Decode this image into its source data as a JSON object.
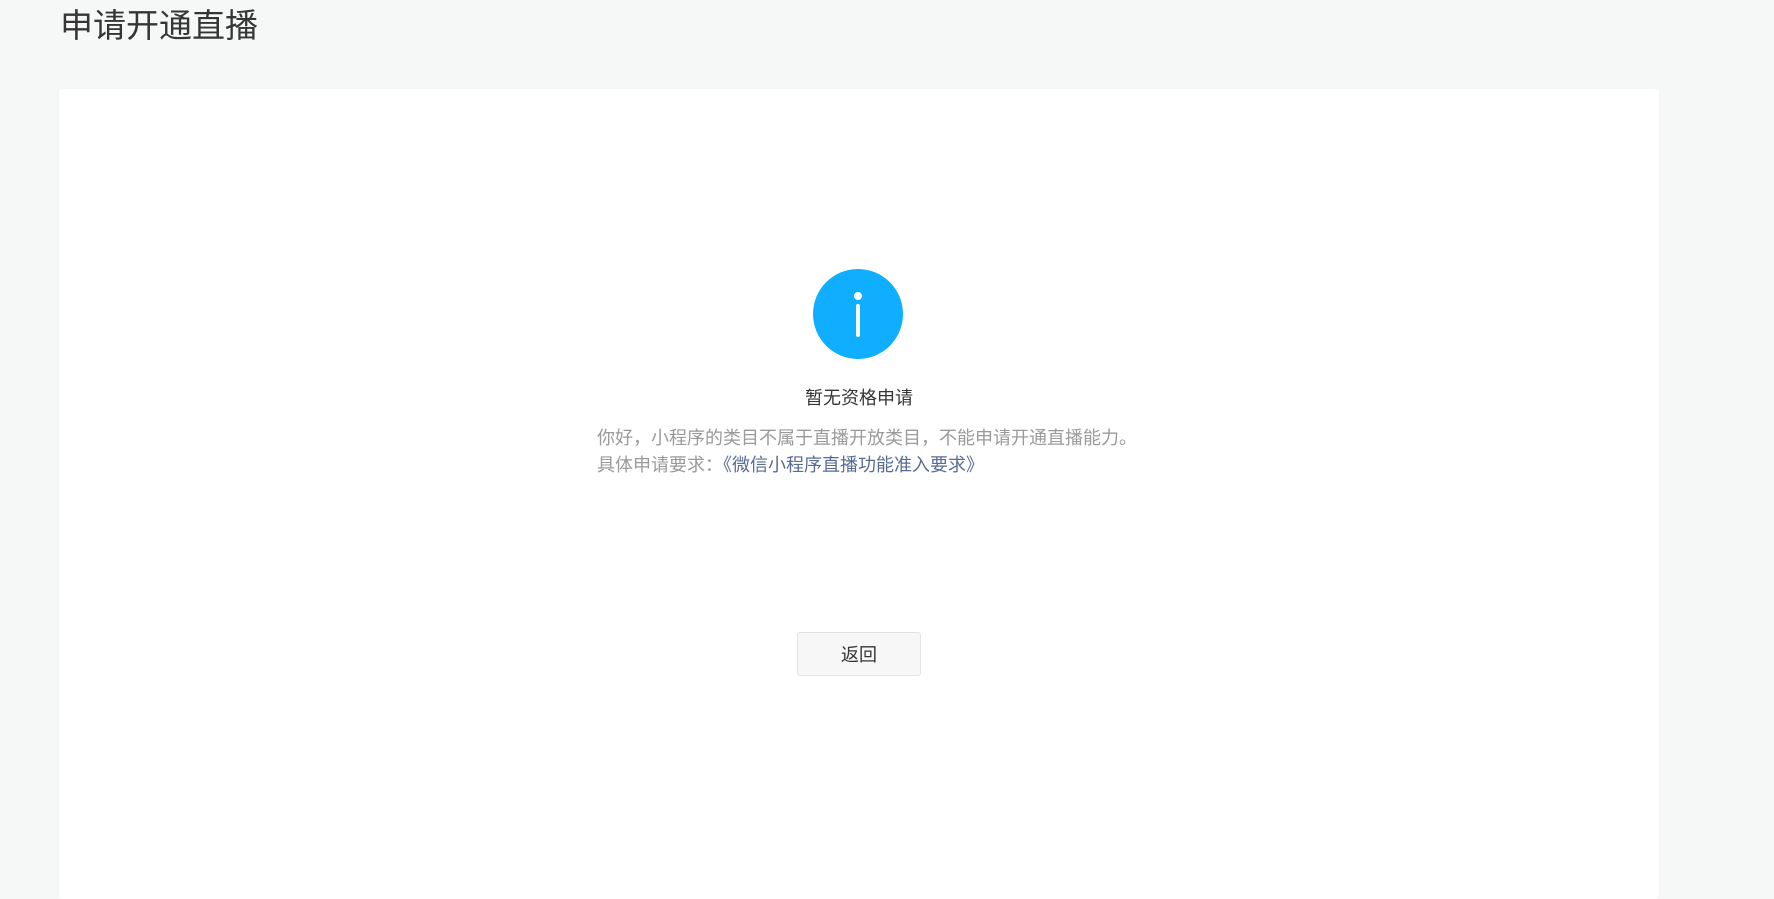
{
  "header": {
    "title": "申请开通直播"
  },
  "message": {
    "icon": "info-icon",
    "icon_color": "#10aeff",
    "title": "暂无资格申请",
    "description_line1": "你好，小程序的类目不属于直播开放类目，不能申请开通直播能力。",
    "description_line2_prefix": "具体申请要求：",
    "requirements_link": "《微信小程序直播功能准入要求》",
    "link_color": "#576b95"
  },
  "actions": {
    "back_label": "返回"
  }
}
